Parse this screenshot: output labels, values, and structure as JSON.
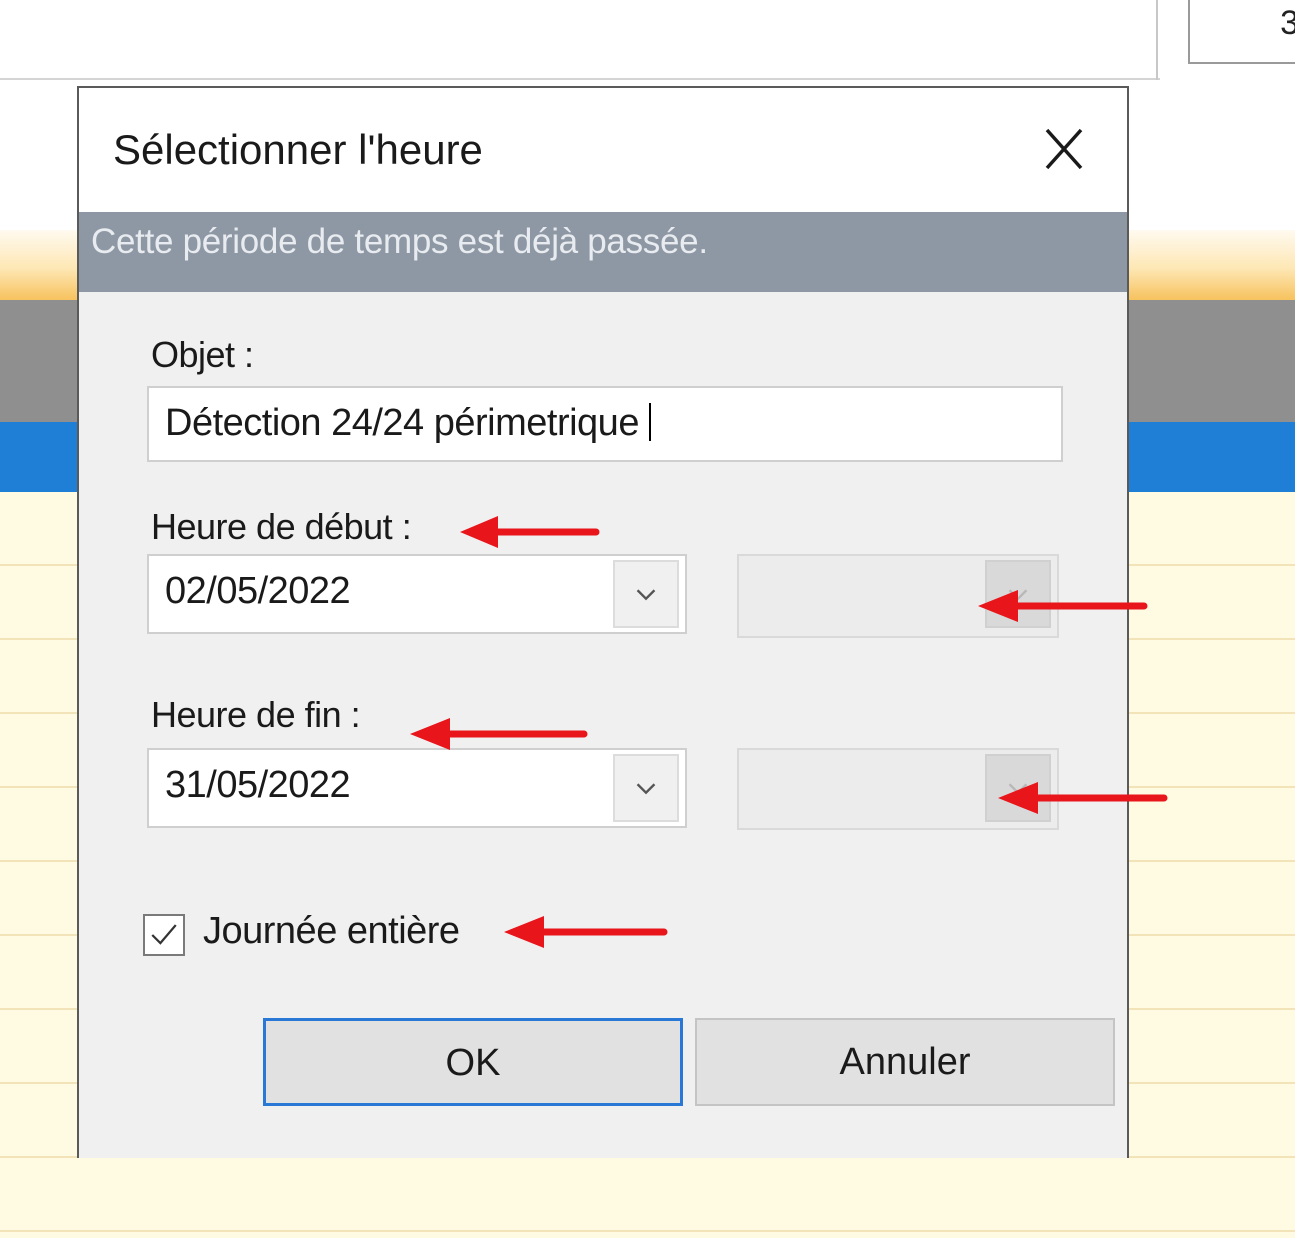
{
  "background": {
    "corner_cell_text": "3"
  },
  "dialog": {
    "title": "Sélectionner l'heure",
    "info_message": "Cette période de temps est déjà passée.",
    "subject": {
      "label": "Objet :",
      "value": "Détection 24/24 périmetrique"
    },
    "start": {
      "label": "Heure de début :",
      "date": "02/05/2022",
      "time": ""
    },
    "end": {
      "label": "Heure de fin :",
      "date": "31/05/2022",
      "time": ""
    },
    "all_day": {
      "label": "Journée entière",
      "checked": true
    },
    "buttons": {
      "ok": "OK",
      "cancel": "Annuler"
    }
  },
  "colors": {
    "info_bar": "#8e98a5",
    "ok_focus_border": "#2a78d6",
    "annotation_arrow": "#e8151b",
    "calendar_blue": "#1f7fd6",
    "calendar_yellow": "#fffbe3"
  },
  "icons": {
    "close": "close-icon",
    "dropdown": "chevron-down-icon",
    "check": "checkmark-icon",
    "annotation": "red-arrow-left-icon"
  }
}
